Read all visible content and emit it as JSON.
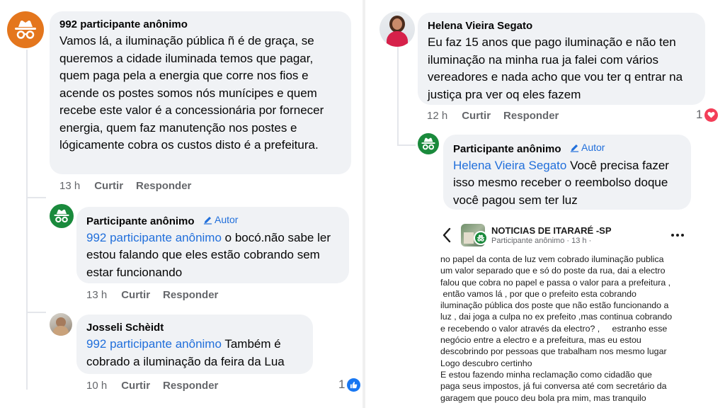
{
  "left": {
    "comments": [
      {
        "name": "992 participante anônimo",
        "text": "Vamos lá, a iluminação pública ñ é de graça, se queremos a cidade iluminada temos que pagar, quem paga pela a energia que corre nos fios e acende os postes somos nós munícipes e quem recebe este valor é a concessionária por fornecer energia, quem faz manutenção nos postes e lógicamente cobra os custos disto é a prefeitura.",
        "time": "13 h",
        "like": "Curtir",
        "reply": "Responder"
      },
      {
        "name": "Participante anônimo",
        "badge": "Autor",
        "tag": "992 participante anônimo",
        "text": " o bocó.não sabe ler estou falando que eles estão cobrando sem estar funcionando",
        "time": "13 h",
        "like": "Curtir",
        "reply": "Responder"
      },
      {
        "name": "Josseli Schèidt",
        "tag": "992 participante anônimo",
        "text": " Também é cobrado a iluminação da feira da Lua",
        "time": "10 h",
        "like": "Curtir",
        "reply": "Responder",
        "reaction_count": "1"
      }
    ]
  },
  "right": {
    "comments": [
      {
        "name": "Helena Vieira Segato",
        "text": "Eu faz 15 anos que pago iluminação e não ten iluminação na minha rua ja falei com vários vereadores e nada acho que vou ter q entrar na justiça pra ver oq eles fazem",
        "time": "12 h",
        "like": "Curtir",
        "reply": "Responder",
        "reaction_count": "1"
      },
      {
        "name": "Participante anônimo",
        "badge": "Autor",
        "tag": "Helena Vieira Segato",
        "text": " Você precisa fazer isso mesmo receber o reembolso doque você pagou sem ter luz"
      }
    ],
    "post": {
      "group": "NOTICIAS DE ITARARÉ -SP",
      "author_line": "Participante anônimo · 13 h ·",
      "body": "no papel da conta de luz vem cobrado iluminação publica\num valor separado que e só do poste da rua, dai a electro\nfalou que cobra no papel e passa o valor para a prefeitura ,\n então vamos lá , por que o prefeito esta cobrando\niluminação pública dos poste que não estão funcionando a\nluz , dai joga a culpa no ex prefeito ,mas continua cobrando\ne recebendo o valor através da electro? ,     estranho esse\nnegócio entre a electro e a prefeitura, mas eu estou\ndescobrindo por pessoas que trabalham nos mesmo lugar\nLogo descubro certinho\nE estou fazendo minha reclamação como cidadão que\npaga seus impostos, já fui conversa até com secretário da\ngaragem que pouco deu bola pra mim, mas tranquilo"
    }
  },
  "colors": {
    "bubble": "#f0f2f5",
    "tag": "#216fdb",
    "meta": "#65676b",
    "anon_orange": "#e4761d",
    "anon_green": "#1a8a3c",
    "like_blue": "#1877f2",
    "love_red": "#f33e58"
  }
}
